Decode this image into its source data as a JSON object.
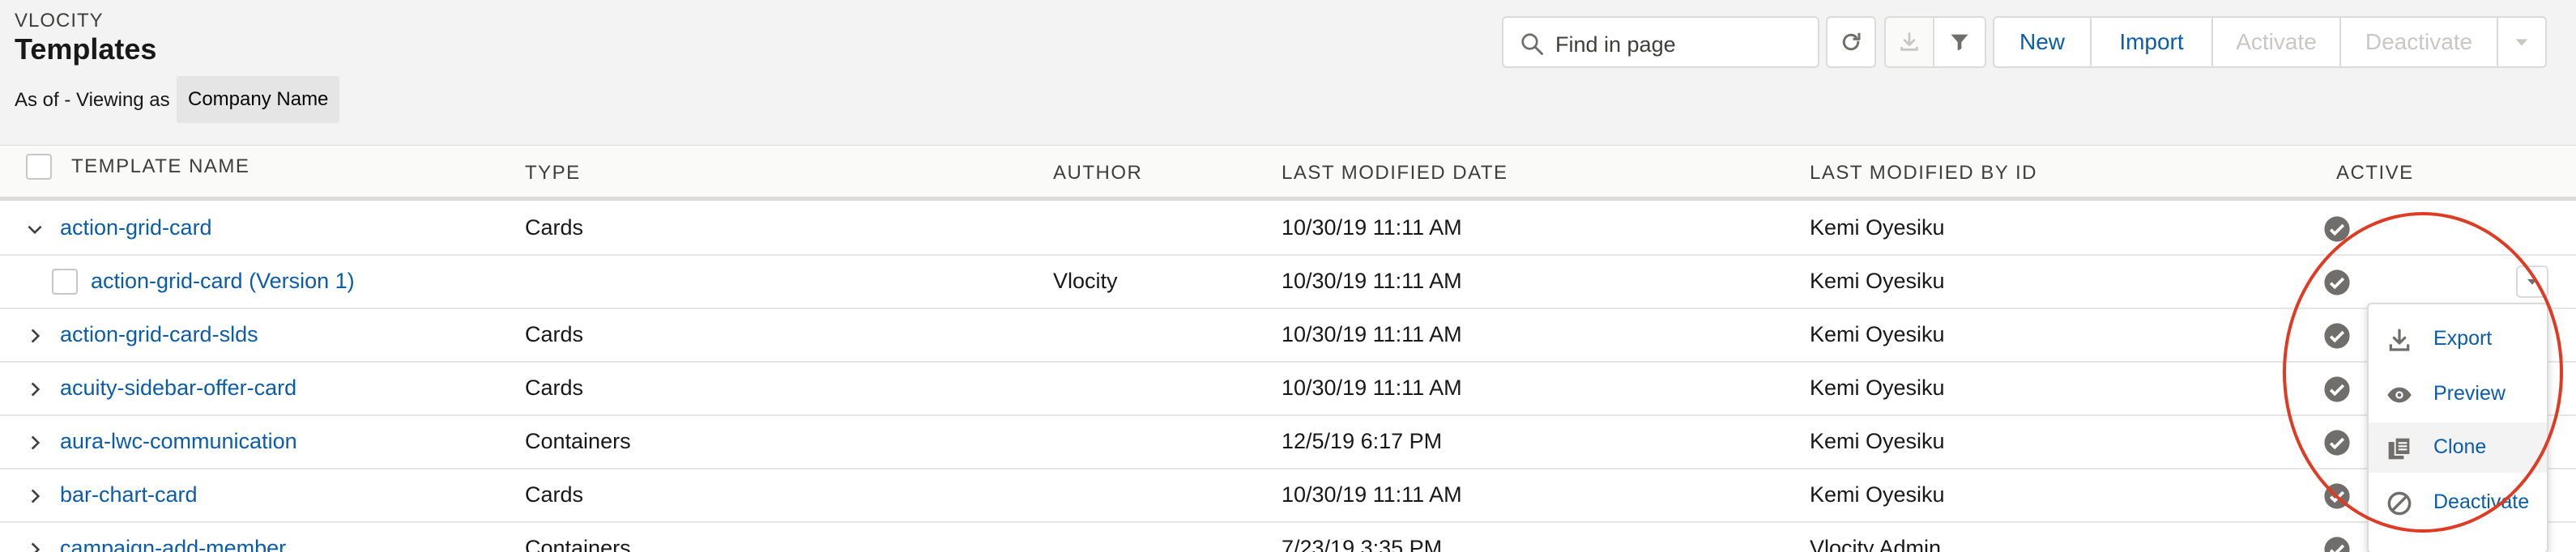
{
  "header": {
    "eyebrow": "VLOCITY",
    "title": "Templates",
    "viewing_label": "As of - Viewing as",
    "viewing_value": "Company Name"
  },
  "search": {
    "placeholder": "Find in page"
  },
  "toolbar": {
    "new": "New",
    "import": "Import",
    "activate": "Activate",
    "deactivate": "Deactivate"
  },
  "columns": {
    "name": "TEMPLATE NAME",
    "type": "TYPE",
    "author": "AUTHOR",
    "modified_date": "LAST MODIFIED DATE",
    "modified_by": "LAST MODIFIED BY ID",
    "active": "ACTIVE"
  },
  "rows": [
    {
      "name": "action-grid-card",
      "type": "Cards",
      "author": "",
      "date": "10/30/19 11:11 AM",
      "by": "Kemi Oyesiku",
      "expanded": true
    },
    {
      "name": "action-grid-card (Version 1)",
      "type": "",
      "author": "Vlocity",
      "date": "10/30/19 11:11 AM",
      "by": "Kemi Oyesiku",
      "version": true
    },
    {
      "name": "action-grid-card-slds",
      "type": "Cards",
      "author": "",
      "date": "10/30/19 11:11 AM",
      "by": "Kemi Oyesiku"
    },
    {
      "name": "acuity-sidebar-offer-card",
      "type": "Cards",
      "author": "",
      "date": "10/30/19 11:11 AM",
      "by": "Kemi Oyesiku"
    },
    {
      "name": "aura-lwc-communication",
      "type": "Containers",
      "author": "",
      "date": "12/5/19 6:17 PM",
      "by": "Kemi Oyesiku"
    },
    {
      "name": "bar-chart-card",
      "type": "Cards",
      "author": "",
      "date": "10/30/19 11:11 AM",
      "by": "Kemi Oyesiku"
    },
    {
      "name": "campaign-add-member",
      "type": "Containers",
      "author": "",
      "date": "7/23/19 3:35 PM",
      "by": "Vlocity Admin"
    }
  ],
  "row_menu": {
    "items": [
      {
        "label": "Export",
        "icon": "download-icon"
      },
      {
        "label": "Preview",
        "icon": "eye-icon"
      },
      {
        "label": "Clone",
        "icon": "copy-icon"
      },
      {
        "label": "Deactivate",
        "icon": "ban-icon"
      }
    ]
  },
  "colors": {
    "link": "#0b5cab",
    "highlight": "#e03a22",
    "header_bg": "#f3f3f3"
  }
}
